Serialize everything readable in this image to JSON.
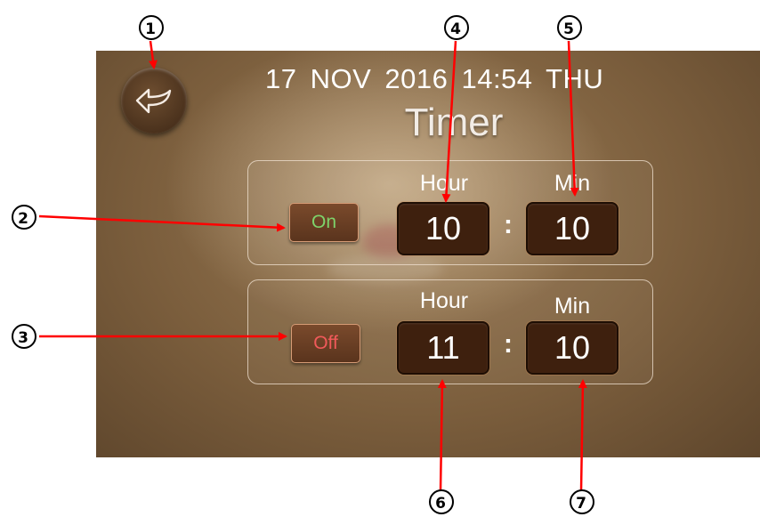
{
  "status": {
    "datetime": "17  NOV  2016  14:54  THU"
  },
  "page": {
    "title": "Timer"
  },
  "timer_on": {
    "toggle_label": "On",
    "hour_label": "Hour",
    "min_label": "Min",
    "hour_value": "10",
    "min_value": "10",
    "separator": ":"
  },
  "timer_off": {
    "toggle_label": "Off",
    "hour_label": "Hour",
    "min_label": "Min",
    "hour_value": "11",
    "min_value": "10",
    "separator": ":"
  },
  "callouts": {
    "c1": "1",
    "c2": "2",
    "c3": "3",
    "c4": "4",
    "c5": "5",
    "c6": "6",
    "c7": "7"
  },
  "colors": {
    "arrow": "#ff0000",
    "on_text": "#7ed36a",
    "off_text": "#f05a5a",
    "value_box": "#3e200e"
  },
  "icons": {
    "back": "return-arrow-icon"
  }
}
